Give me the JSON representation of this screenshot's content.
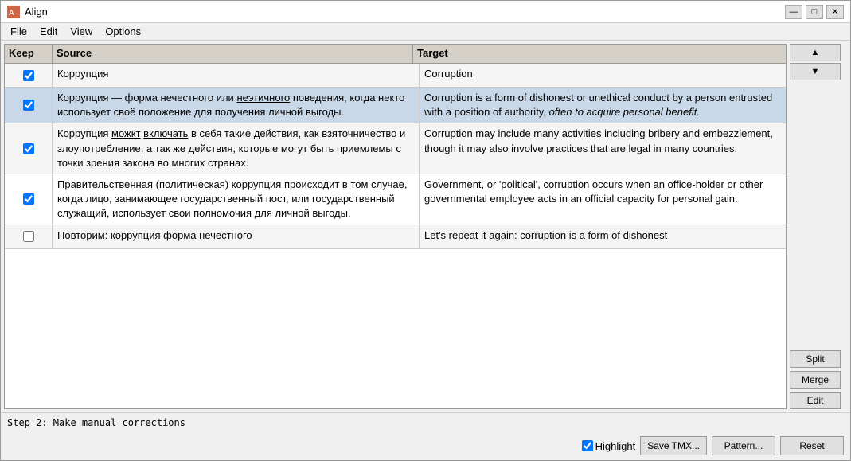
{
  "window": {
    "title": "Align",
    "icon": "align-icon"
  },
  "menu": {
    "items": [
      "File",
      "Edit",
      "View",
      "Options"
    ]
  },
  "table": {
    "headers": {
      "keep": "Keep",
      "source": "Source",
      "target": "Target"
    },
    "rows": [
      {
        "id": 1,
        "checked": true,
        "source": "Коррупция",
        "target": "Corruption",
        "selected": false
      },
      {
        "id": 2,
        "checked": true,
        "source": "Коррупция  —  форма нечестного или неэтичного поведения, когда некто использует своё положение для получения личной выгоды.",
        "target": "Corruption is a form of dishonest or unethical conduct by a person entrusted with a position of authority, often to acquire personal benefit.",
        "selected": true,
        "source_underline_parts": [
          "неэтичного"
        ],
        "target_italic_parts": [
          "often to acquire personal benefit."
        ]
      },
      {
        "id": 3,
        "checked": true,
        "source": "Коррупция можкт включать в себя такие действия, как взяточничество и злоупотребление, а так же действия, которые могут быть приемлемы с точки зрения закона во многих странах.",
        "target": "Corruption may include many activities including bribery and embezzlement, though it may also involve practices that are legal in many countries.",
        "selected": false,
        "source_underline_parts": [
          "можкт",
          "включать"
        ]
      },
      {
        "id": 4,
        "checked": true,
        "source": "Правительственная (политическая) коррупция происходит в том случае, когда лицо, занимающее государственный пост, или государственный служащий, использует свои полномочия для личной выгоды.",
        "target": "Government, or 'political', corruption occurs when an office-holder or other governmental employee acts in an official capacity for personal gain.",
        "selected": false
      },
      {
        "id": 5,
        "checked": false,
        "source": "Повторим: коррупция  форма нечестного",
        "target": "Let's repeat it again: corruption is a form of dishonest",
        "selected": false
      }
    ]
  },
  "right_panel": {
    "up_arrow": "▲",
    "down_arrow": "▼",
    "split_label": "Split",
    "merge_label": "Merge",
    "edit_label": "Edit"
  },
  "status_bar": {
    "text": "Step 2: Make manual corrections"
  },
  "bottom_bar": {
    "highlight_label": "Highlight",
    "highlight_checked": true,
    "save_tmx_label": "Save TMX...",
    "pattern_label": "Pattern...",
    "reset_label": "Reset"
  }
}
